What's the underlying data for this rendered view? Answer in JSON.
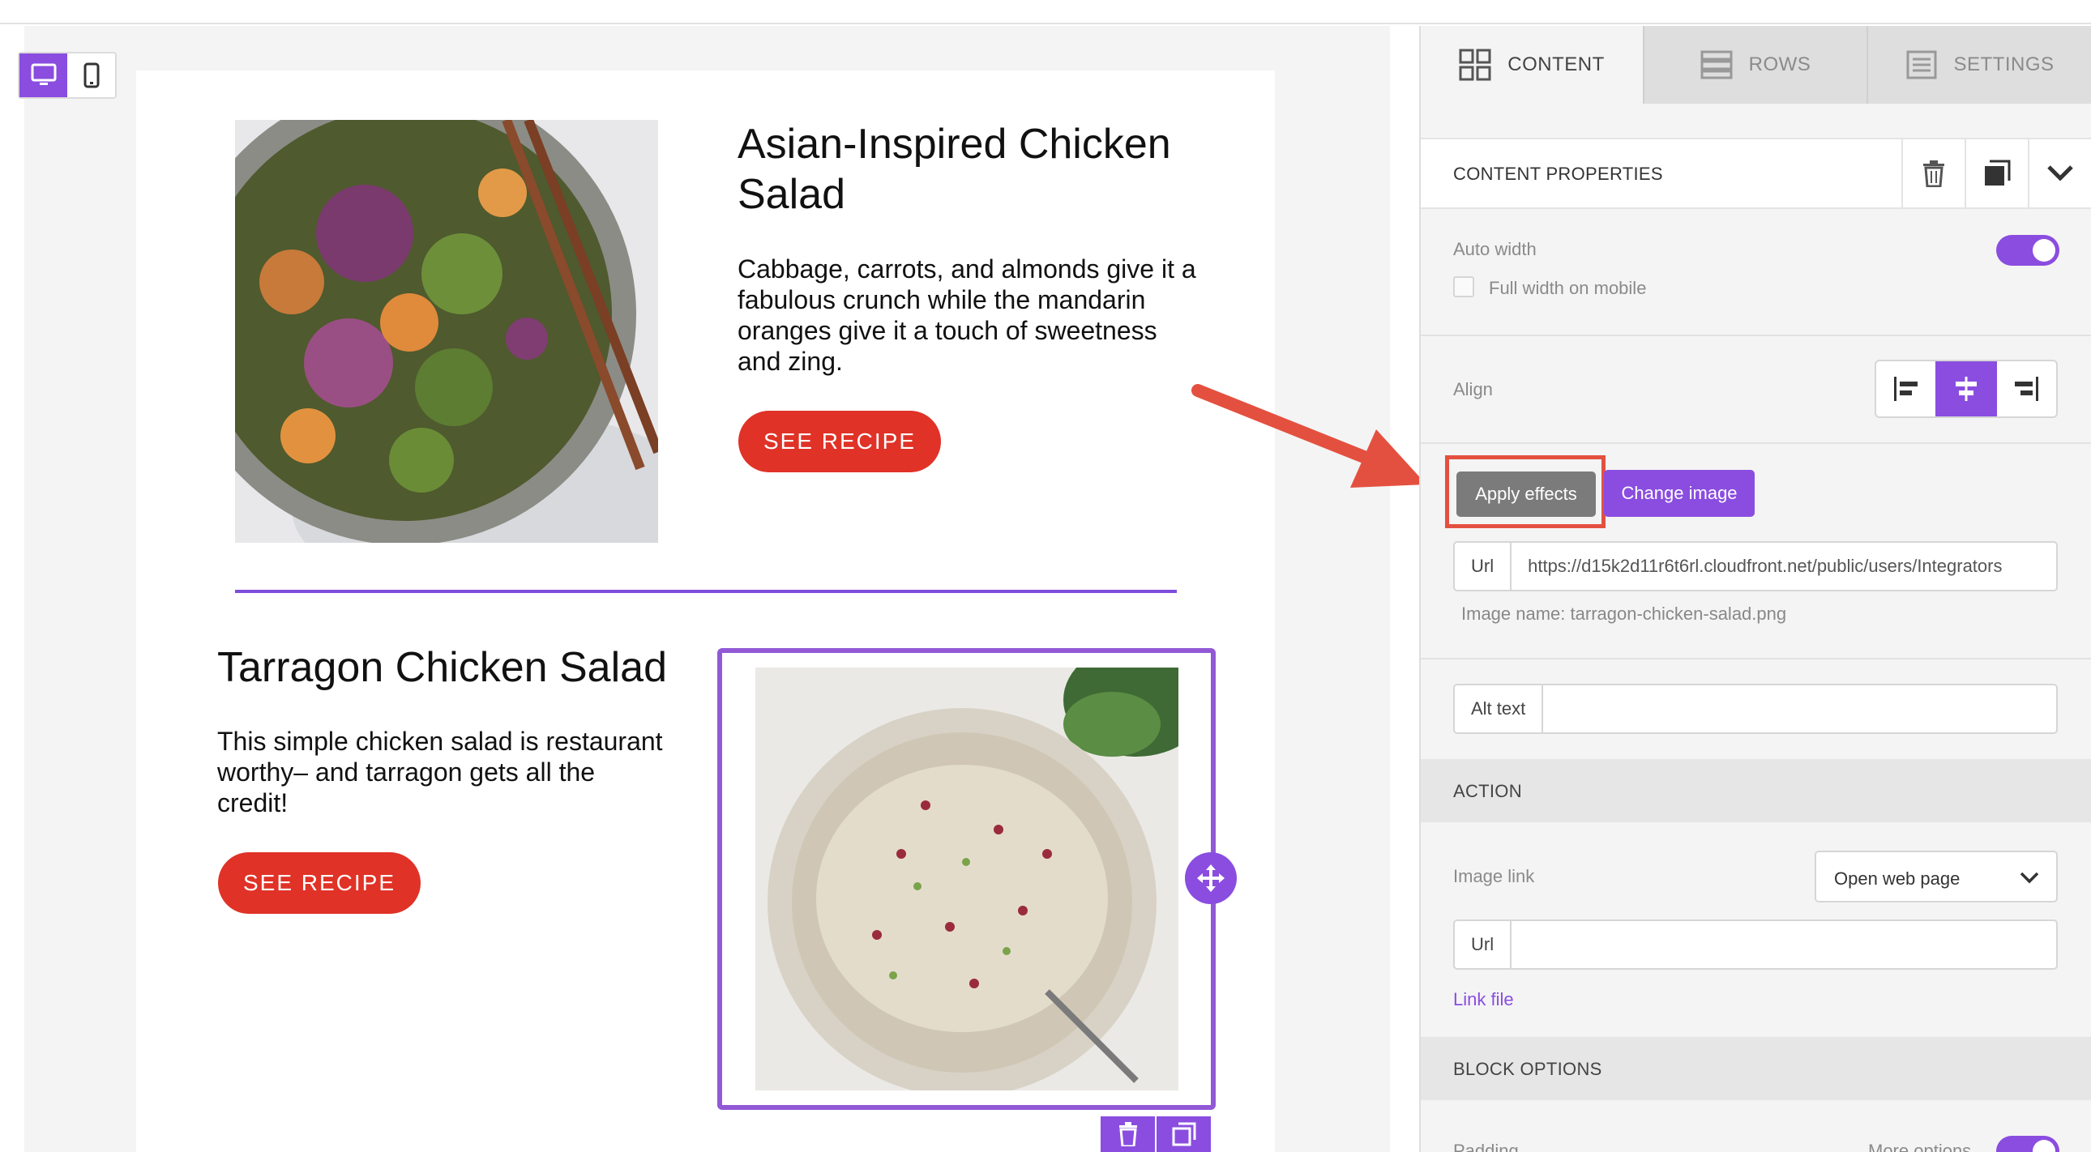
{
  "editor": {
    "device_toggle": {
      "desktop": "desktop-icon",
      "mobile": "mobile-icon",
      "active": "desktop"
    }
  },
  "email": {
    "card1": {
      "title": "Asian-Inspired Chicken Salad",
      "title_line1": "Asian-Inspired Chicken",
      "title_line2": "Salad",
      "description_lines": [
        "Cabbage, carrots, and almonds give it a",
        "fabulous crunch while the mandarin",
        "oranges give it a touch of sweetness",
        "and zing."
      ],
      "button": "SEE RECIPE"
    },
    "card2": {
      "title": "Tarragon Chicken Salad",
      "description_lines": [
        "This simple chicken salad is restaurant",
        "worthy– and tarragon gets all the",
        "credit!"
      ],
      "button": "SEE RECIPE"
    }
  },
  "panel": {
    "tabs": [
      {
        "label": "CONTENT",
        "icon": "grid-icon",
        "active": true
      },
      {
        "label": "ROWS",
        "icon": "rows-icon",
        "active": false
      },
      {
        "label": "SETTINGS",
        "icon": "settings-list-icon",
        "active": false
      }
    ],
    "content_properties": {
      "title": "CONTENT PROPERTIES",
      "icons": [
        "trash-icon",
        "duplicate-icon",
        "chevron-down-icon"
      ]
    },
    "auto_width": {
      "label": "Auto width",
      "on": true
    },
    "full_width_mobile": {
      "label": "Full width on mobile",
      "checked": false
    },
    "align": {
      "label": "Align",
      "options": [
        "align-left-icon",
        "align-center-icon",
        "align-right-icon"
      ],
      "selected": "align-center-icon"
    },
    "buttons": {
      "apply_effects": "Apply effects",
      "change_image": "Change image"
    },
    "url": {
      "prefix": "Url",
      "value": "https://d15k2d11r6t6rl.cloudfront.net/public/users/Integrators"
    },
    "image_name": "Image name: tarragon-chicken-salad.png",
    "alt_text": {
      "prefix": "Alt text",
      "value": ""
    },
    "action": {
      "heading": "ACTION",
      "image_link_label": "Image link",
      "image_link_value": "Open web page",
      "url_prefix": "Url",
      "url_value": "",
      "link_file": "Link file"
    },
    "block_options": {
      "heading": "BLOCK OPTIONS",
      "padding_label": "Padding",
      "more_options_label": "More options",
      "more_options_on": true
    },
    "colors": {
      "accent": "#8a4de0",
      "cta_red": "#e03227",
      "highlight": "#e4503f"
    }
  }
}
